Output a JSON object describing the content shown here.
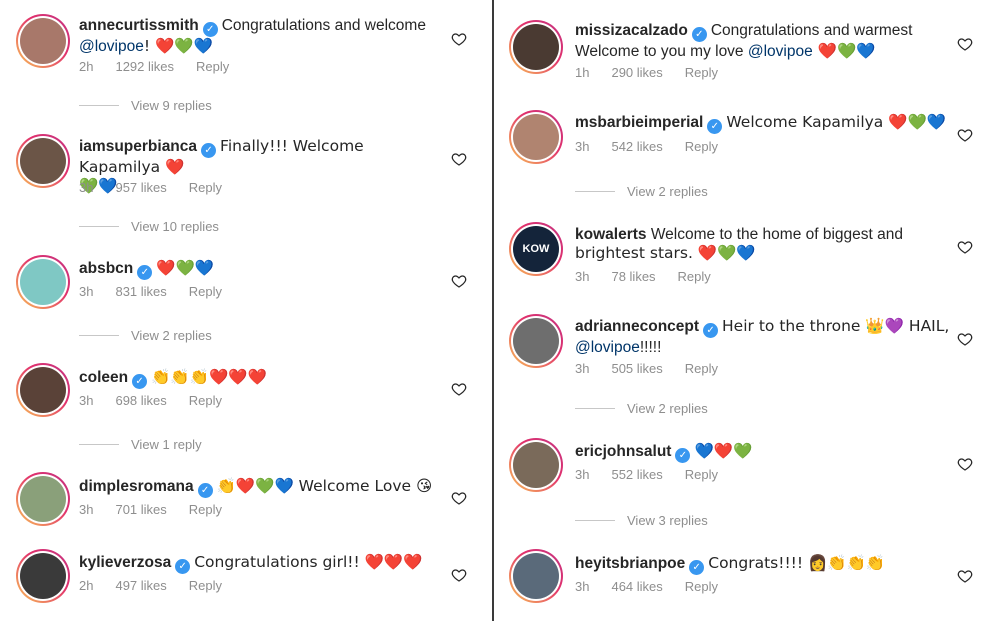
{
  "left": [
    {
      "username": "annecurtissmith",
      "verified": true,
      "text": "Congratulations and welcome",
      "mention": "@lovipoe",
      "suffix": "! ❤️💚💙",
      "time": "2h",
      "likes": "1292 likes",
      "reply": "Reply",
      "view_replies": "View 9 replies",
      "avatar_color": "#a8786a"
    },
    {
      "username": "iamsuperbianca",
      "verified": true,
      "text": "Finally!!! Welcome Kapamilya ❤️",
      "line2": "💚💙",
      "time": "3h",
      "likes": "957 likes",
      "reply": "Reply",
      "view_replies": "View 10 replies",
      "avatar_color": "#6b5547"
    },
    {
      "username": "absbcn",
      "verified": true,
      "text": "❤️💚💙",
      "time": "3h",
      "likes": "831 likes",
      "reply": "Reply",
      "view_replies": "View 2 replies",
      "avatar_color": "#7fc8c4"
    },
    {
      "username": "coleen",
      "verified": true,
      "text": "👏👏👏❤️❤️❤️",
      "time": "3h",
      "likes": "698 likes",
      "reply": "Reply",
      "view_replies": "View 1 reply",
      "avatar_color": "#5a4238"
    },
    {
      "username": "dimplesromana",
      "verified": true,
      "text": "👏❤️💚💙 Welcome Love 😘",
      "time": "3h",
      "likes": "701 likes",
      "reply": "Reply",
      "view_replies": "",
      "avatar_color": "#8aa07a"
    },
    {
      "username": "kylieverzosa",
      "verified": true,
      "text": "Congratulations girl!! ❤️❤️❤️",
      "time": "2h",
      "likes": "497 likes",
      "reply": "Reply",
      "view_replies": "",
      "avatar_color": "#3a3a3a"
    }
  ],
  "right": [
    {
      "username": "missizacalzado",
      "verified": true,
      "text": "Congratulations and warmest",
      "line2_prefix": "Welcome to you my love ",
      "mention": "@lovipoe",
      "suffix": " ❤️💚💙",
      "time": "1h",
      "likes": "290 likes",
      "reply": "Reply",
      "view_replies": "",
      "avatar_color": "#4a3a32"
    },
    {
      "username": "msbarbieimperial",
      "verified": true,
      "text": "Welcome Kapamilya ❤️💚💙",
      "time": "3h",
      "likes": "542 likes",
      "reply": "Reply",
      "view_replies": "View 2 replies",
      "avatar_color": "#b08470"
    },
    {
      "username": "kowalerts",
      "verified": false,
      "text": "Welcome to the home of  biggest and",
      "line2": "brightest stars. ❤️💚💙",
      "time": "3h",
      "likes": "78 likes",
      "reply": "Reply",
      "view_replies": "",
      "avatar_color": "#14243a",
      "avatar_text": "KOW"
    },
    {
      "username": "adrianneconcept",
      "verified": true,
      "text": "Heir to the throne 👑💜 HAIL,",
      "mention_line2": "@lovipoe",
      "suffix2": "!!!!!",
      "time": "3h",
      "likes": "505 likes",
      "reply": "Reply",
      "view_replies": "View 2 replies",
      "avatar_color": "#6e6e6e"
    },
    {
      "username": "ericjohnsalut",
      "verified": true,
      "text": "💙❤️💚",
      "time": "3h",
      "likes": "552 likes",
      "reply": "Reply",
      "view_replies": "View 3 replies",
      "avatar_color": "#7a6a5a"
    },
    {
      "username": "heyitsbrianpoe",
      "verified": true,
      "text": "Congrats!!!! 👩👏👏👏",
      "time": "3h",
      "likes": "464 likes",
      "reply": "Reply",
      "view_replies": "",
      "avatar_color": "#5a6a7a"
    }
  ],
  "icons": {
    "heart": "heart-outline-icon",
    "verified": "verified-badge-icon"
  }
}
